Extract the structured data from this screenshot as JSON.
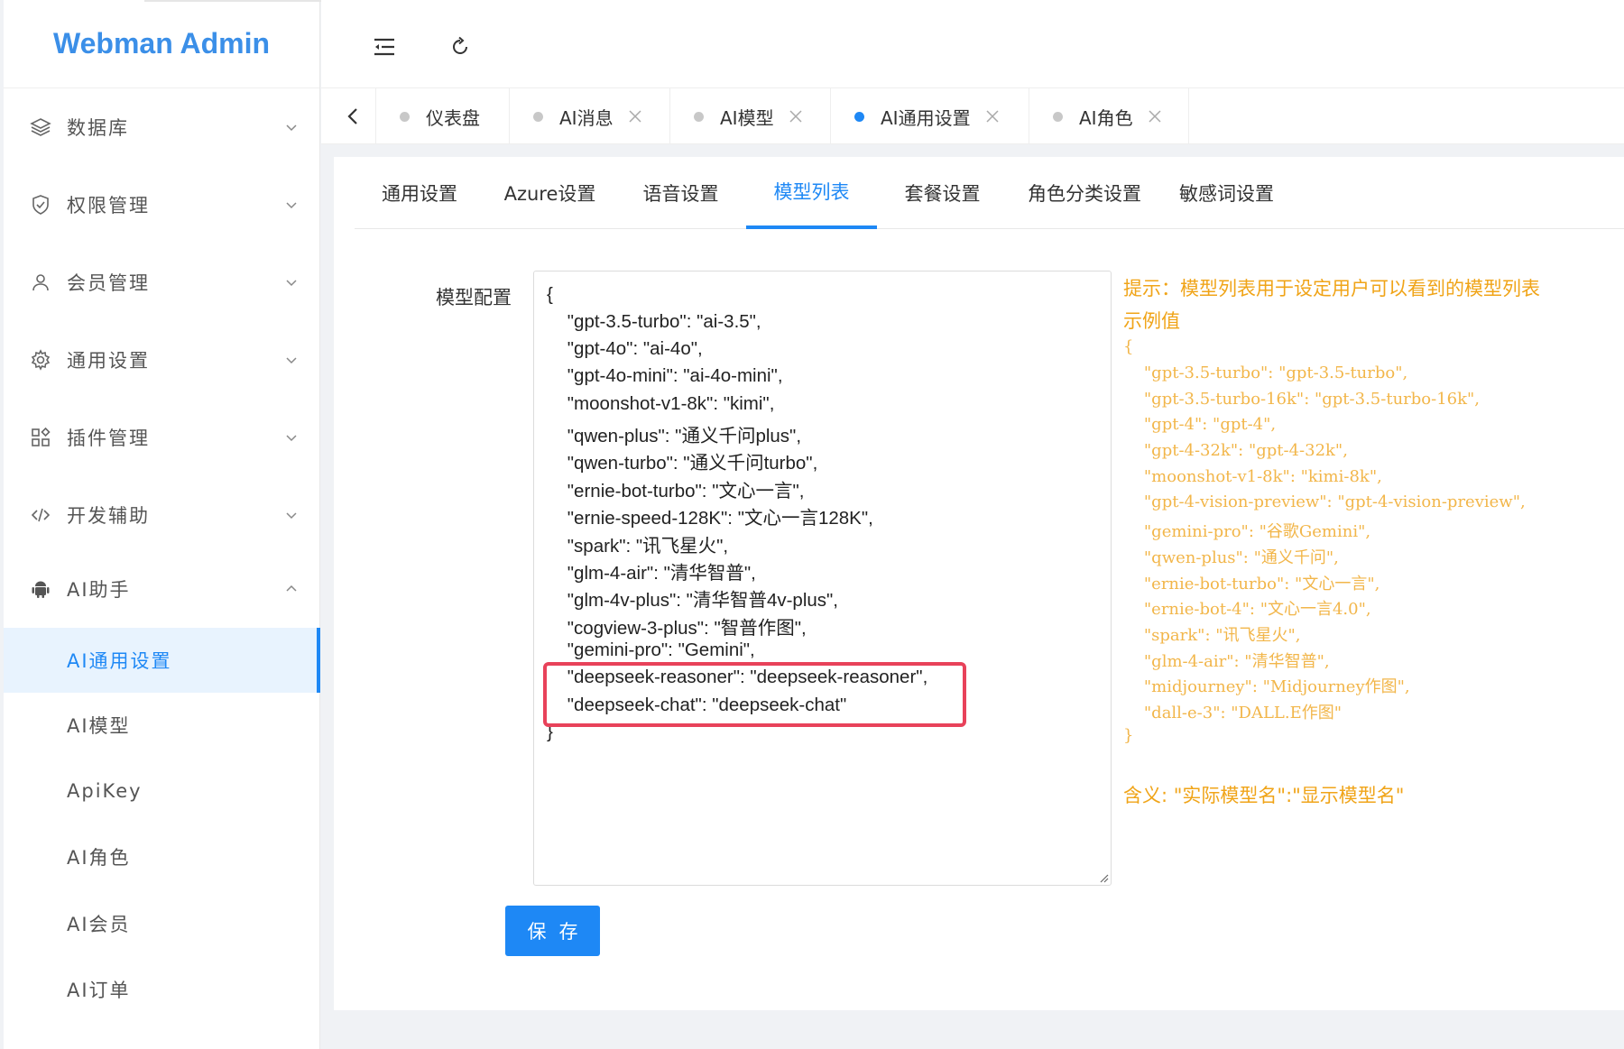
{
  "brand": "Webman Admin",
  "sidebar": {
    "menus": [
      {
        "label": "数据库",
        "icon": "layers-icon"
      },
      {
        "label": "权限管理",
        "icon": "shield-icon"
      },
      {
        "label": "会员管理",
        "icon": "user-icon"
      },
      {
        "label": "通用设置",
        "icon": "gear-icon"
      },
      {
        "label": "插件管理",
        "icon": "apps-icon"
      },
      {
        "label": "开发辅助",
        "icon": "code-icon"
      },
      {
        "label": "AI助手",
        "icon": "android-icon"
      }
    ],
    "submenu": [
      {
        "label": "AI通用设置"
      },
      {
        "label": "AI模型"
      },
      {
        "label": "ApiKey"
      },
      {
        "label": "AI角色"
      },
      {
        "label": "AI会员"
      },
      {
        "label": "AI订单"
      }
    ]
  },
  "tabs": [
    {
      "label": "仪表盘"
    },
    {
      "label": "AI消息"
    },
    {
      "label": "AI模型"
    },
    {
      "label": "AI通用设置"
    },
    {
      "label": "AI角色"
    }
  ],
  "subtabs": [
    "通用设置",
    "Azure设置",
    "语音设置",
    "模型列表",
    "套餐设置",
    "角色分类设置",
    "敏感词设置"
  ],
  "form": {
    "label": "模型配置",
    "code_lines": [
      "{",
      "    \"gpt-3.5-turbo\": \"ai-3.5\",",
      "    \"gpt-4o\": \"ai-4o\",",
      "    \"gpt-4o-mini\": \"ai-4o-mini\",",
      "    \"moonshot-v1-8k\": \"kimi\",",
      "    \"qwen-plus\": \"通义千问plus\",",
      "    \"qwen-turbo\": \"通义千问turbo\",",
      "    \"ernie-bot-turbo\": \"文心一言\",",
      "    \"ernie-speed-128K\": \"文心一言128K\",",
      "    \"spark\": \"讯飞星火\",",
      "    \"glm-4-air\": \"清华智普\",",
      "    \"glm-4v-plus\": \"清华智普4v-plus\",",
      "    \"cogview-3-plus\": \"智普作图\",",
      "    \"gemini-pro\": \"Gemini\",",
      "    \"deepseek-reasoner\": \"deepseek-reasoner\",",
      "    \"deepseek-chat\": \"deepseek-chat\"",
      "}"
    ],
    "save_label": "保存"
  },
  "hint": {
    "title": "提示：模型列表用于设定用户可以看到的模型列表",
    "sub": "示例值",
    "example_lines": [
      "{",
      "    \"gpt-3.5-turbo\": \"gpt-3.5-turbo\",",
      "    \"gpt-3.5-turbo-16k\": \"gpt-3.5-turbo-16k\",",
      "    \"gpt-4\": \"gpt-4\",",
      "    \"gpt-4-32k\": \"gpt-4-32k\",",
      "    \"moonshot-v1-8k\": \"kimi-8k\",",
      "    \"gpt-4-vision-preview\": \"gpt-4-vision-preview\",",
      "    \"gemini-pro\": \"谷歌Gemini\",",
      "    \"qwen-plus\": \"通义千问\",",
      "    \"ernie-bot-turbo\": \"文心一言\",",
      "    \"ernie-bot-4\": \"文心一言4.0\",",
      "    \"spark\": \"讯飞星火\",",
      "    \"glm-4-air\": \"清华智普\",",
      "    \"midjourney\": \"Midjourney作图\",",
      "    \"dall-e-3\": \"DALL.E作图\"",
      "}"
    ],
    "meaning": "含义: \"实际模型名\":\"显示模型名\""
  },
  "colors": {
    "accent": "#1e88f5",
    "hint": "#f0a418",
    "highlight": "#e8425a"
  }
}
